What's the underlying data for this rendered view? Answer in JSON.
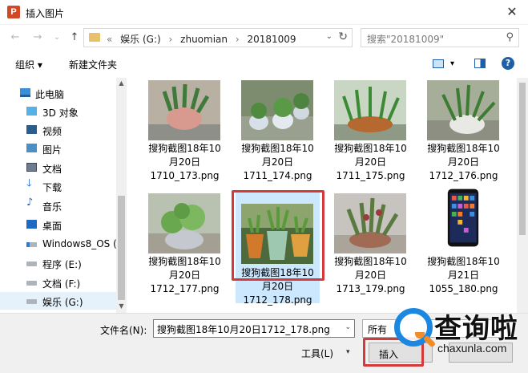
{
  "window": {
    "title": "插入图片",
    "app_icon_letter": "P",
    "close_glyph": "✕"
  },
  "address": {
    "prefix": "«",
    "crumbs": [
      "娱乐 (G:)",
      "zhuomian",
      "20181009"
    ],
    "separator": "›",
    "search_placeholder": "搜索\"20181009\""
  },
  "nav": {
    "back": "←",
    "forward": "→",
    "recent": "⌄",
    "up": "↑",
    "refresh": "↻",
    "dropdown": "⌄",
    "search_glyph": "⚲"
  },
  "toolbar": {
    "organize": "组织 ▾",
    "new_folder": "新建文件夹",
    "view_dropdown": "▾",
    "help": "?"
  },
  "sidebar": {
    "items": [
      {
        "label": "此电脑",
        "icon": "computer-icon"
      },
      {
        "label": "3D 对象",
        "icon": "3d-objects-icon"
      },
      {
        "label": "视频",
        "icon": "video-icon"
      },
      {
        "label": "图片",
        "icon": "pictures-icon"
      },
      {
        "label": "文档",
        "icon": "documents-icon"
      },
      {
        "label": "下载",
        "icon": "download-icon",
        "glyph": "🡓"
      },
      {
        "label": "音乐",
        "icon": "music-icon",
        "glyph": "♪"
      },
      {
        "label": "桌面",
        "icon": "desktop-icon"
      },
      {
        "label": "Windows8_OS (C",
        "icon": "drive-icon"
      },
      {
        "label": "程序 (E:)",
        "icon": "drive-icon"
      },
      {
        "label": "文档 (F:)",
        "icon": "drive-icon"
      },
      {
        "label": "娱乐 (G:)",
        "icon": "drive-icon",
        "selected": true
      }
    ],
    "scroll_up": "▲",
    "scroll_down": "▼"
  },
  "files": [
    {
      "lines": [
        "搜狗截图18年10",
        "月20日",
        "1710_173.png"
      ]
    },
    {
      "lines": [
        "搜狗截图18年10",
        "月20日",
        "1711_174.png"
      ]
    },
    {
      "lines": [
        "搜狗截图18年10",
        "月20日",
        "1711_175.png"
      ]
    },
    {
      "lines": [
        "搜狗截图18年10",
        "月20日",
        "1712_176.png"
      ]
    },
    {
      "lines": [
        "搜狗截图18年10",
        "月20日",
        "1712_177.png"
      ]
    },
    {
      "lines": [
        "搜狗截图18年10",
        "月20日",
        "1712_178.png"
      ],
      "selected": true
    },
    {
      "lines": [
        "搜狗截图18年10",
        "月20日",
        "1713_179.png"
      ]
    },
    {
      "lines": [
        "搜狗截图18年10",
        "月21日",
        "1055_180.png"
      ]
    }
  ],
  "bottom": {
    "filename_label": "文件名(N):",
    "filename_value": "搜狗截图18年10月20日1712_178.png",
    "type_value": "所有",
    "tools_label": "工具(L)",
    "tools_dd": "▾",
    "insert_label": "插入",
    "dd_glyph": "⌄"
  },
  "watermark": {
    "text_cn": "查询啦",
    "url": "chaxunla.com"
  },
  "colors": {
    "accent": "#1e5fa8",
    "highlight_red": "#d33a3a",
    "selection": "#cce8ff",
    "watermark_blue": "#1a88e0",
    "watermark_orange": "#f28c28"
  }
}
